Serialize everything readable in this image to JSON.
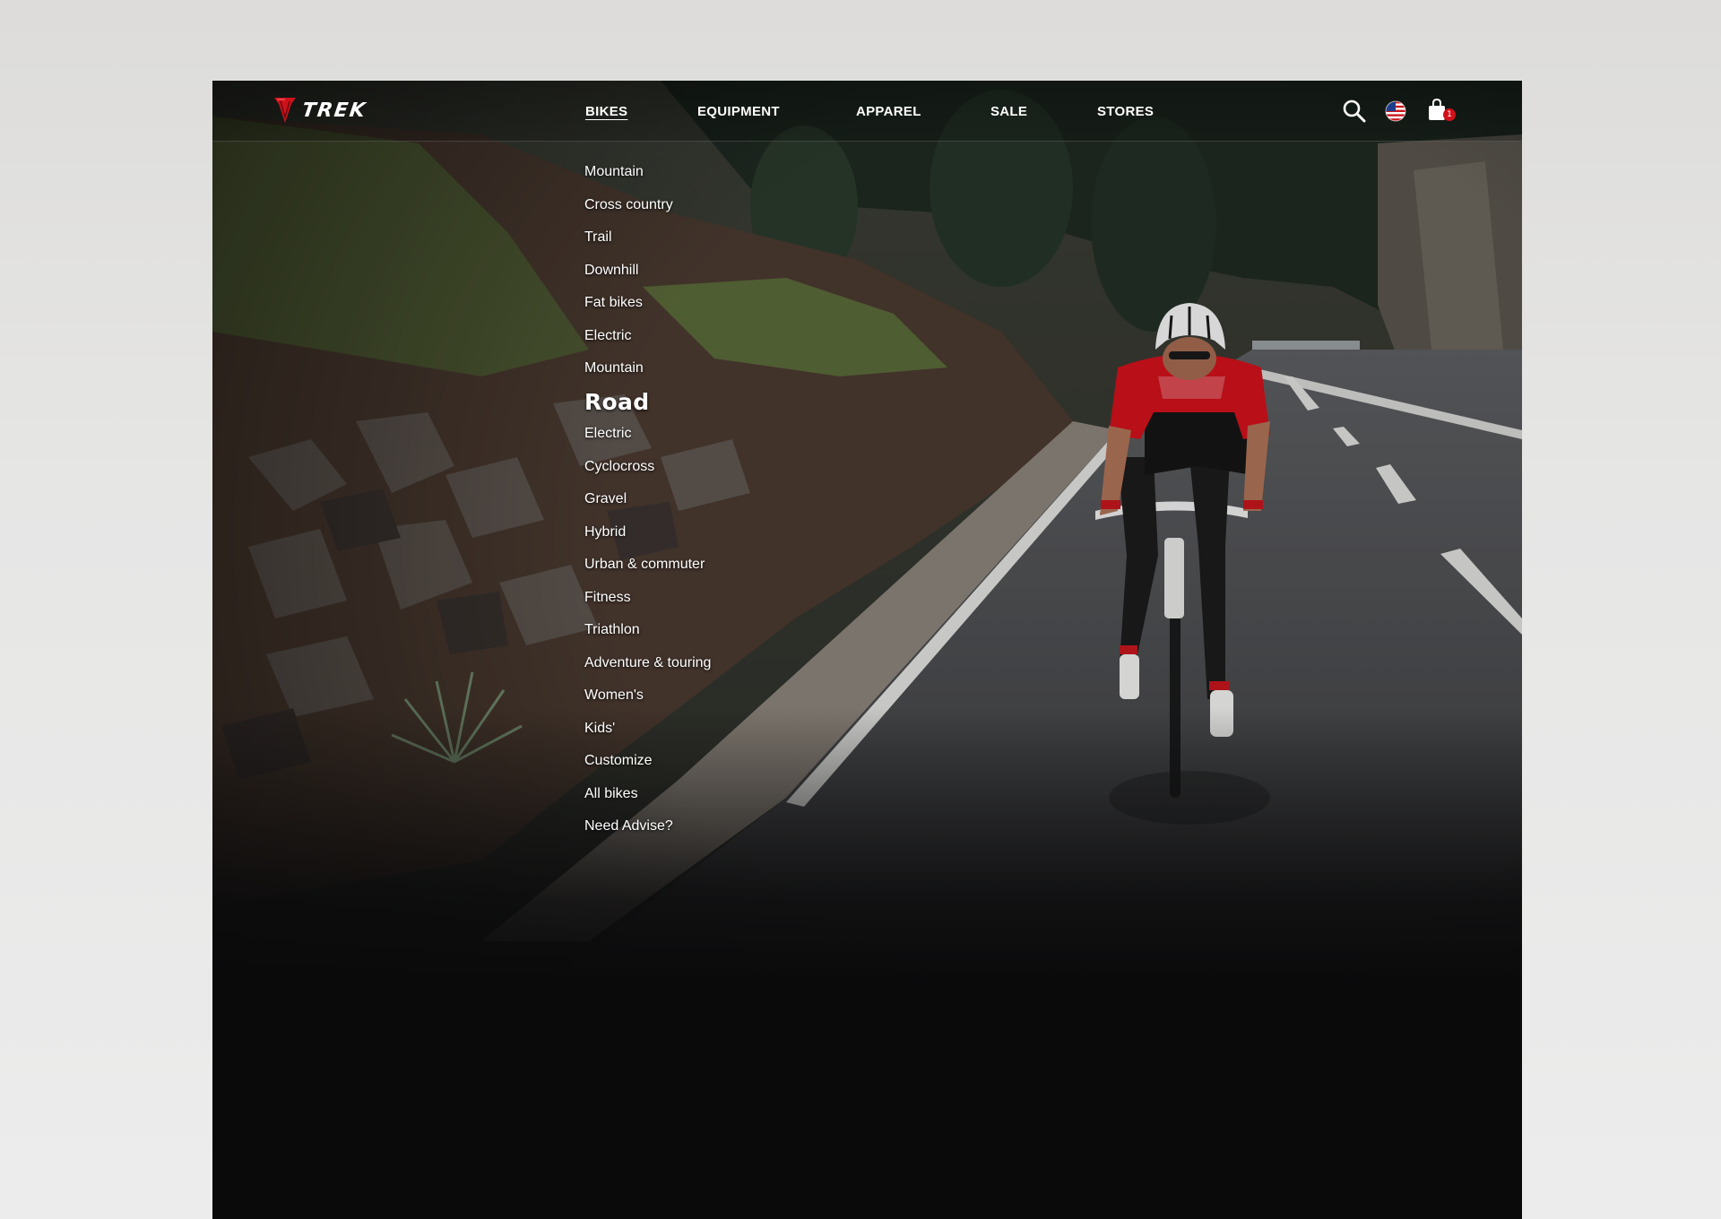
{
  "brand": {
    "name": "TREK"
  },
  "nav": {
    "items": [
      {
        "label": "BIKES",
        "active": true
      },
      {
        "label": "EQUIPMENT",
        "active": false
      },
      {
        "label": "APPAREL",
        "active": false
      },
      {
        "label": "SALE",
        "active": false
      },
      {
        "label": "STORES",
        "active": false
      }
    ]
  },
  "header_icons": {
    "search": "search-icon",
    "locale": "us-flag-icon",
    "cart": "shopping-bag-icon",
    "cart_count": "1"
  },
  "bikes_menu": {
    "items": [
      "Mountain",
      "Cross country",
      "Trail",
      "Downhill",
      "Fat bikes",
      "Electric",
      "Mountain",
      "Road",
      "Electric",
      "Cyclocross",
      "Gravel",
      "Hybrid",
      "Urban & commuter",
      "Fitness",
      "Triathlon",
      "Adventure & touring",
      "Women's",
      "Kids'",
      "Customize",
      "All bikes",
      "Need Advise?"
    ],
    "highlighted": "Road"
  },
  "colors": {
    "brand_red": "#d0111b",
    "background": "#0a0a0b",
    "text": "#ffffff"
  }
}
